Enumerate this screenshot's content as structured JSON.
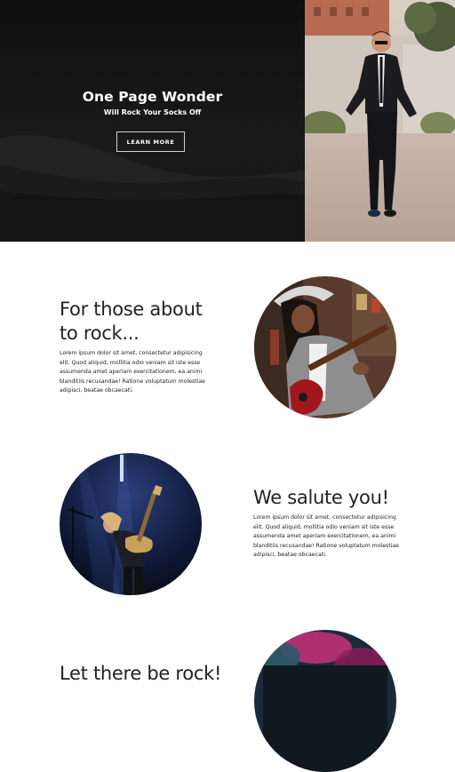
{
  "hero": {
    "title": "One Page Wonder",
    "subtitle": "Will Rock Your Socks Off",
    "button_label": "LEARN MORE",
    "photo_alt": "man in suit walking on street"
  },
  "sections": [
    {
      "heading": "For those about to rock...",
      "body": "Lorem ipsum dolor sit amet, consectetur adipisicing elit. Quod aliquid, mollitia odio veniam sit iste esse assumenda amet aperiam exercitationem, ea animi blanditiis recusandae! Ratione voluptatum molestiae adipisci, beatae obcaecati.",
      "image": "woman playing red electric guitar"
    },
    {
      "heading": "We salute you!",
      "body": "Lorem ipsum dolor sit amet, consectetur adipisicing elit. Quod aliquid, mollitia odio veniam sit iste esse assumenda amet aperiam exercitationem, ea animi blanditiis recusandae! Ratione voluptatum molestiae adipisci, beatae obcaecati.",
      "image": "guitarist performing on stage"
    },
    {
      "heading": "Let there be rock!",
      "image": "concert crowd with pink lights"
    }
  ],
  "colors": {
    "hero_background": "#141414",
    "page_background": "#ffffff",
    "text": "#222222"
  }
}
